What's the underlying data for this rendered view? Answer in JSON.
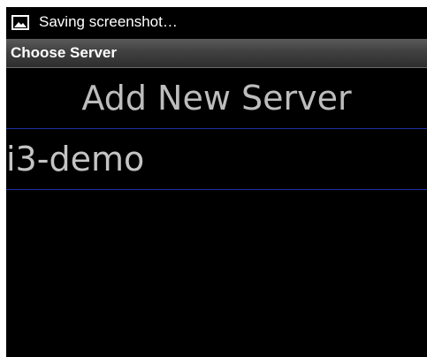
{
  "status_bar": {
    "notification_icon": "image-icon",
    "text": "Saving screenshot…"
  },
  "title_bar": {
    "title": "Choose Server"
  },
  "add_server": {
    "label": "Add New Server"
  },
  "servers": [
    {
      "name": "i3-demo"
    }
  ],
  "colors": {
    "background": "#000000",
    "divider": "#1f2fa0",
    "text": "#c4c4c4",
    "title_bar": "#404040"
  }
}
